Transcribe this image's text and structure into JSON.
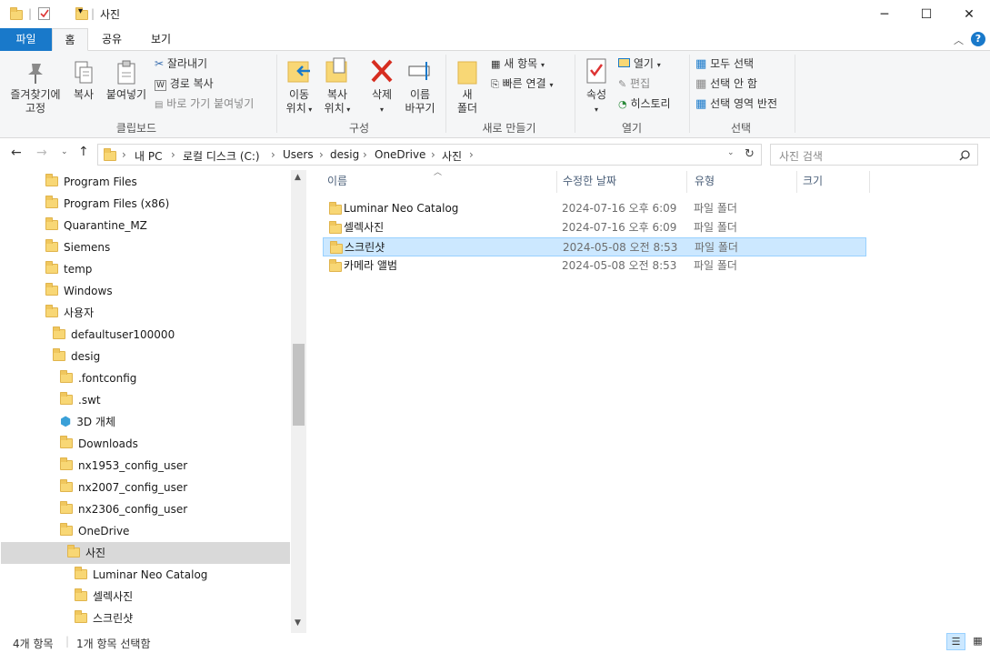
{
  "title": "사진",
  "tabs": [
    "파일",
    "홈",
    "공유",
    "보기"
  ],
  "ribbon": {
    "clipboard": {
      "pin": "즐겨찾기에\n고정",
      "copy": "복사",
      "paste": "붙여넣기",
      "cut": "잘라내기",
      "copy_path": "경로 복사",
      "paste_shortcut": "바로 가기 붙여넣기",
      "label": "클립보드"
    },
    "organize": {
      "move_to": "이동\n위치",
      "copy_to": "복사\n위치",
      "delete": "삭제",
      "rename": "이름\n바꾸기",
      "label": "구성"
    },
    "new": {
      "new_folder": "새\n폴더",
      "new_item": "새 항목",
      "easy_access": "빠른 연결",
      "label": "새로 만들기"
    },
    "open": {
      "properties": "속성",
      "open": "열기",
      "edit": "편집",
      "history": "히스토리",
      "label": "열기"
    },
    "select": {
      "select_all": "모두 선택",
      "select_none": "선택 안 함",
      "invert": "선택 영역 반전",
      "label": "선택"
    }
  },
  "address": {
    "crumbs": [
      "내 PC",
      "로컬 디스크 (C:)",
      "Users",
      "desig",
      "OneDrive",
      "사진"
    ],
    "search_placeholder": "사진 검색"
  },
  "nav": {
    "items": [
      {
        "label": "Program Files",
        "indent": 0
      },
      {
        "label": "Program Files (x86)",
        "indent": 0
      },
      {
        "label": "Quarantine_MZ",
        "indent": 0
      },
      {
        "label": "Siemens",
        "indent": 0
      },
      {
        "label": "temp",
        "indent": 0
      },
      {
        "label": "Windows",
        "indent": 0
      },
      {
        "label": "사용자",
        "indent": 0
      },
      {
        "label": "defaultuser100000",
        "indent": 1
      },
      {
        "label": "desig",
        "indent": 1
      },
      {
        "label": ".fontconfig",
        "indent": 2
      },
      {
        "label": ".swt",
        "indent": 2
      },
      {
        "label": "3D 개체",
        "indent": 2
      },
      {
        "label": "Downloads",
        "indent": 2
      },
      {
        "label": "nx1953_config_user",
        "indent": 2
      },
      {
        "label": "nx2007_config_user",
        "indent": 2
      },
      {
        "label": "nx2306_config_user",
        "indent": 2
      },
      {
        "label": "OneDrive",
        "indent": 2
      },
      {
        "label": "사진",
        "indent": 3
      },
      {
        "label": "Luminar Neo Catalog",
        "indent": 4
      },
      {
        "label": "셀렉사진",
        "indent": 4
      },
      {
        "label": "스크린샷",
        "indent": 4
      }
    ]
  },
  "columns": [
    "이름",
    "수정한 날짜",
    "유형",
    "크기"
  ],
  "files": [
    {
      "name": "Luminar Neo Catalog",
      "date": "2024-07-16 오후 6:09",
      "type": "파일 폴더"
    },
    {
      "name": "셀렉사진",
      "date": "2024-07-16 오후 6:09",
      "type": "파일 폴더"
    },
    {
      "name": "스크린샷",
      "date": "2024-05-08 오전 8:53",
      "type": "파일 폴더"
    },
    {
      "name": "카메라 앨범",
      "date": "2024-05-08 오전 8:53",
      "type": "파일 폴더"
    }
  ],
  "status": {
    "count": "4개 항목",
    "selected": "1개 항목 선택함"
  },
  "colors": {
    "accent": "#1979ca",
    "selection": "#cce8ff",
    "folder": "#f8d775"
  }
}
